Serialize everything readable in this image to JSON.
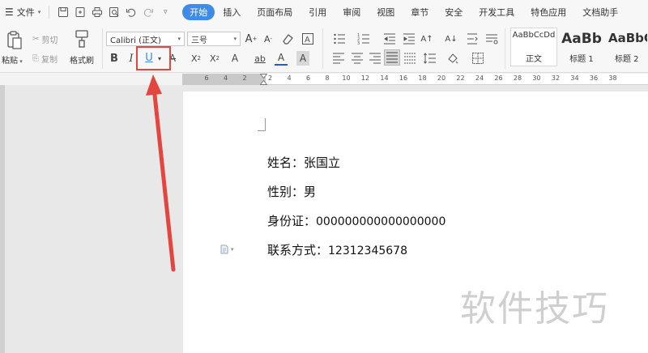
{
  "menubar": {
    "file_label": "文件",
    "tabs": [
      {
        "label": "开始",
        "active": true
      },
      {
        "label": "插入",
        "active": false
      },
      {
        "label": "页面布局",
        "active": false
      },
      {
        "label": "引用",
        "active": false
      },
      {
        "label": "审阅",
        "active": false
      },
      {
        "label": "视图",
        "active": false
      },
      {
        "label": "章节",
        "active": false
      },
      {
        "label": "安全",
        "active": false
      },
      {
        "label": "开发工具",
        "active": false
      },
      {
        "label": "特色应用",
        "active": false
      },
      {
        "label": "文档助手",
        "active": false
      }
    ],
    "active_color": "#3f8ce8"
  },
  "ribbon": {
    "paste_label": "粘贴",
    "cut_label": "剪切",
    "copy_label": "复制",
    "format_painter_label": "格式刷",
    "font_name": "Calibri (正文)",
    "font_size": "三号",
    "bold_glyph": "B",
    "italic_glyph": "I",
    "underline_glyph": "U",
    "styles": [
      {
        "sample": "AaBbCcDd",
        "name": "正文"
      },
      {
        "sample": "AaBb",
        "name": "标题 1"
      },
      {
        "sample": "AaBbC",
        "name": "标题 2"
      }
    ],
    "highlight_color": "#e2463f"
  },
  "ruler": {
    "numbers": [
      "6",
      "4",
      "2",
      "2",
      "4",
      "6",
      "8",
      "10",
      "12",
      "14",
      "16",
      "18",
      "20",
      "22",
      "24",
      "26",
      "28",
      "30",
      "32",
      "34",
      "36",
      "38"
    ]
  },
  "document": {
    "lines": [
      {
        "label": "姓名：",
        "value": "张国立"
      },
      {
        "label": "性别：",
        "value": "男"
      },
      {
        "label": "身份证：",
        "value": "000000000000000000"
      },
      {
        "label": "联系方式：",
        "value": "12312345678"
      }
    ]
  },
  "watermark": "软件技巧",
  "annotation_color": "#e2463f"
}
